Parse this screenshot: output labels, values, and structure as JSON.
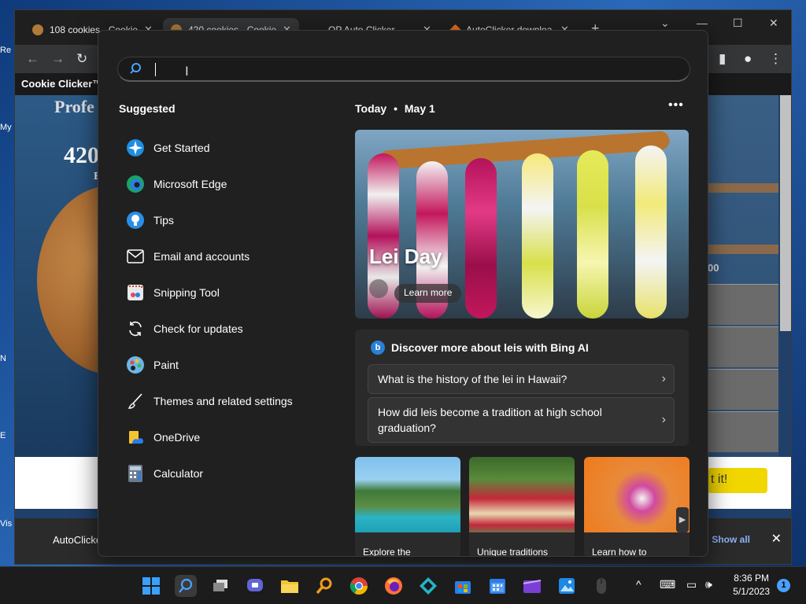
{
  "desktop": {
    "icon_labels": [
      "Re",
      "My",
      "N",
      "E",
      "Vis"
    ]
  },
  "browser": {
    "tabs": [
      {
        "label": "108 cookies - Cookie",
        "active": false
      },
      {
        "label": "420 cookies - Cookie",
        "active": true
      },
      {
        "label": "OP Auto Clicker",
        "active": false
      },
      {
        "label": "AutoClicker downloa",
        "active": false
      }
    ],
    "bookmark_label": "Cookie Clicker™",
    "page_heading_fragment": "Profe",
    "page_count_fragment": "420",
    "page_small_fragment": "E",
    "cta_fragment": "t it!",
    "side_number_fragment": "00",
    "download_bar": {
      "item_label": "AutoClicke",
      "show_all_label": "Show all"
    }
  },
  "search": {
    "input_value": "",
    "suggested_title": "Suggested",
    "suggested": [
      {
        "label": "Get Started",
        "icon": "get-started-icon"
      },
      {
        "label": "Microsoft Edge",
        "icon": "edge-icon"
      },
      {
        "label": "Tips",
        "icon": "tips-icon"
      },
      {
        "label": "Email and accounts",
        "icon": "mail-icon"
      },
      {
        "label": "Snipping Tool",
        "icon": "snipping-tool-icon"
      },
      {
        "label": "Check for updates",
        "icon": "refresh-icon"
      },
      {
        "label": "Paint",
        "icon": "paint-icon"
      },
      {
        "label": "Themes and related settings",
        "icon": "brush-icon"
      },
      {
        "label": "OneDrive",
        "icon": "onedrive-icon"
      },
      {
        "label": "Calculator",
        "icon": "calculator-icon"
      }
    ],
    "today_label": "Today",
    "today_date": "May 1",
    "hero": {
      "title": "Lei Day",
      "cta": "Learn more"
    },
    "bing": {
      "heading": "Discover more about leis with Bing AI",
      "questions": [
        "What is the history of the lei in Hawaii?",
        "How did leis become a tradition at high school graduation?"
      ]
    },
    "thumbnails": [
      {
        "caption": "Explore the"
      },
      {
        "caption": "Unique traditions"
      },
      {
        "caption": "Learn how to"
      }
    ]
  },
  "taskbar": {
    "icons": [
      "start-icon",
      "search-icon",
      "task-view-icon",
      "chat-icon",
      "file-explorer-icon",
      "magnifier-icon",
      "chrome-icon",
      "firefox-icon",
      "autoclicker-icon",
      "store-icon",
      "calendar-icon",
      "clipchamp-icon",
      "photos-icon",
      "mouse-icon"
    ],
    "time": "8:36 PM",
    "date": "5/1/2023",
    "notification_count": "1"
  },
  "colors": {
    "accent": "#4aa0ff",
    "flyout_bg": "#202020",
    "taskbar_bg": "#1c1c1c"
  }
}
